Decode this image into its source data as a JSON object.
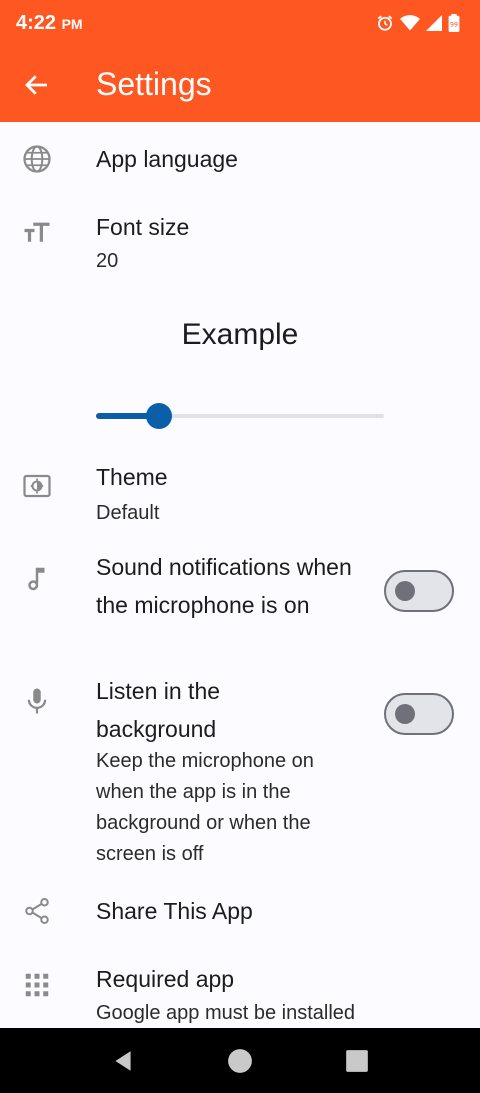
{
  "status": {
    "time": "4:22",
    "ampm": "PM",
    "battery": "99"
  },
  "appbar": {
    "title": "Settings"
  },
  "settings": {
    "language": {
      "title": "App language"
    },
    "font_size": {
      "title": "Font size",
      "value": "20"
    },
    "example": "Example",
    "slider": {
      "value_fraction": 0.22
    },
    "theme": {
      "title": "Theme",
      "value": "Default"
    },
    "sound": {
      "title": "Sound notifications when the microphone is on",
      "enabled": false
    },
    "background": {
      "title": "Listen in the background",
      "description": "Keep the microphone on when the app is in the background or when the screen is off",
      "enabled": false
    },
    "share": {
      "title": "Share This App"
    },
    "required": {
      "title": "Required app",
      "description": "Google app must be installed"
    }
  },
  "colors": {
    "accent": "#ff5722",
    "slider": "#0b5fa8",
    "background": "#fcfbff"
  }
}
